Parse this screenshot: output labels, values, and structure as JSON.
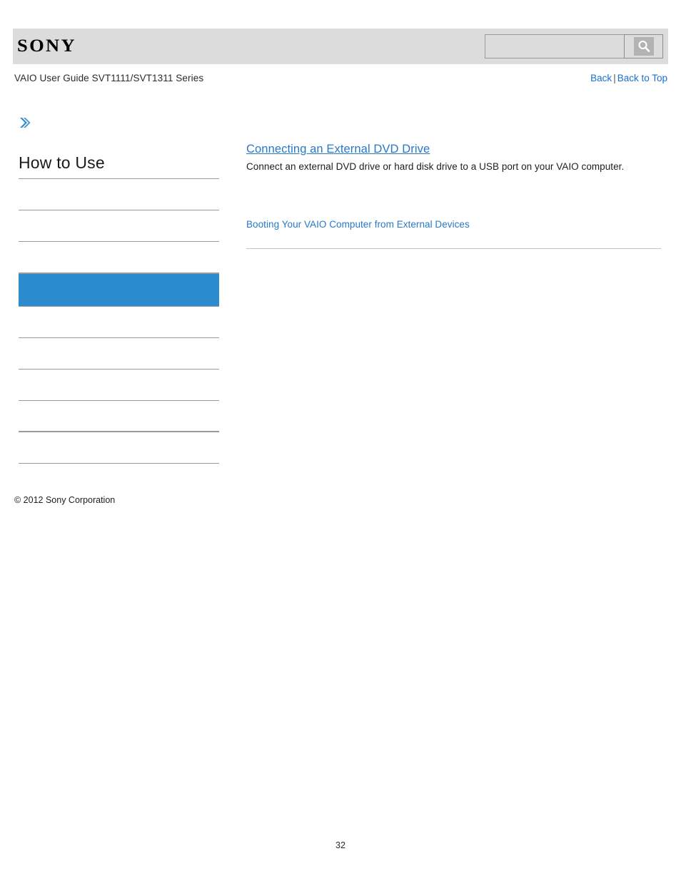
{
  "header": {
    "logo_text": "SONY",
    "logo_icon": "sony-wordmark"
  },
  "search": {
    "value": "",
    "placeholder": "",
    "button_icon": "search-icon",
    "button_label": ""
  },
  "titlebar": {
    "guide_title": "VAIO User Guide SVT1111/SVT1311 Series",
    "back_label": "Back",
    "separator": "|",
    "back_to_top_label": "Back to Top"
  },
  "sidebar": {
    "chevron_icon": "chevron-double-right-icon",
    "heading": "How to Use",
    "items": [
      {
        "label": "",
        "active": false,
        "thick": false
      },
      {
        "label": "",
        "active": false,
        "thick": false
      },
      {
        "label": "",
        "active": false,
        "thick": false
      },
      {
        "label": "",
        "active": true,
        "thick": false
      },
      {
        "label": "",
        "active": false,
        "thick": false
      },
      {
        "label": "",
        "active": false,
        "thick": false
      },
      {
        "label": "",
        "active": false,
        "thick": false
      },
      {
        "label": "",
        "active": false,
        "thick": true
      },
      {
        "label": "",
        "active": false,
        "thick": false
      }
    ]
  },
  "main": {
    "entries": [
      {
        "title": "Connecting an External DVD Drive",
        "description": "Connect an external DVD drive or hard disk drive to a USB port on your VAIO computer."
      }
    ],
    "link": "Booting Your VAIO Computer from External Devices"
  },
  "footer": {
    "copyright": "© 2012 Sony Corporation",
    "page_number": "32"
  },
  "colors": {
    "accent_blue": "#2a8ccd",
    "link_blue": "#2878c8",
    "top_link_blue": "#1a6fd4",
    "header_gray": "#dcdcdc",
    "rule_gray": "#9a9a9a"
  }
}
